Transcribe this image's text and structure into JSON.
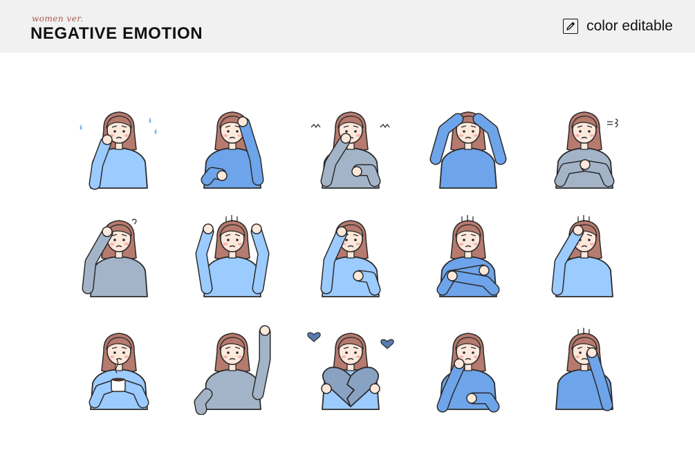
{
  "header": {
    "subtitle": "women ver.",
    "title": "NEGATIVE EMOTION",
    "badge_label": "color editable",
    "badge_icon": "eyedropper-icon"
  },
  "colors": {
    "header_bg": "#f1f1f1",
    "skin": "#fde8dc",
    "hair": "#b67a6e",
    "outline": "#2a2a2a",
    "shirt_light": "#9ccbff",
    "shirt_mid": "#6ea4ea",
    "shirt_gray": "#a4b4c8",
    "sweat_drop": "#7fb8f0",
    "blush": "#f6b8b0"
  },
  "illustrations": [
    {
      "name": "worried-sweating",
      "shirt": "light",
      "pose": "hand-cheek",
      "effect": "drops"
    },
    {
      "name": "headache",
      "shirt": "mid",
      "pose": "hand-head",
      "effect": "none"
    },
    {
      "name": "nervous-biting-nails",
      "shirt": "gray",
      "pose": "bite-nails",
      "effect": "shake"
    },
    {
      "name": "frustrated-hands-behind-head",
      "shirt": "mid",
      "pose": "arms-behind-head",
      "effect": "none"
    },
    {
      "name": "sighing",
      "shirt": "gray",
      "pose": "clasped-hands",
      "effect": "sigh"
    },
    {
      "name": "confused",
      "shirt": "gray",
      "pose": "scratch-head",
      "effect": "question"
    },
    {
      "name": "angry-fists-raised",
      "shirt": "light",
      "pose": "fists-up",
      "effect": "anger"
    },
    {
      "name": "anxious",
      "shirt": "light",
      "pose": "hand-forehead-fist",
      "effect": "none"
    },
    {
      "name": "cold-shivering",
      "shirt": "mid",
      "pose": "arms-crossed",
      "effect": "shiver"
    },
    {
      "name": "embarrassed",
      "shirt": "light",
      "pose": "hand-forehead",
      "effect": "lines"
    },
    {
      "name": "tired-with-coffee",
      "shirt": "light",
      "pose": "holding-cup",
      "effect": "steam"
    },
    {
      "name": "shocked-waving",
      "shirt": "gray",
      "pose": "arm-raised",
      "effect": "none"
    },
    {
      "name": "heartbroken",
      "shirt": "light",
      "pose": "holding-broken-heart",
      "effect": "broken-hearts"
    },
    {
      "name": "bored-leaning",
      "shirt": "mid",
      "pose": "chin-on-hand",
      "effect": "none"
    },
    {
      "name": "despair",
      "shirt": "mid",
      "pose": "face-in-hand",
      "effect": "lines"
    }
  ]
}
